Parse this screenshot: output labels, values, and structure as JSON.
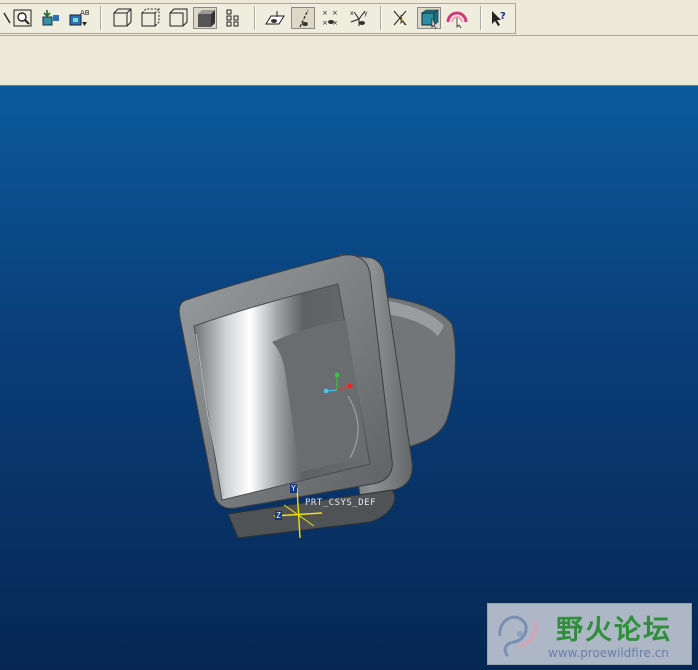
{
  "toolbar": {
    "buttons": [
      {
        "name": "partial-arrow-icon",
        "tooltip": ""
      },
      {
        "name": "zoom-window-icon",
        "tooltip": ""
      },
      {
        "name": "model-insert-icon",
        "tooltip": ""
      },
      {
        "name": "annotation-ab-icon",
        "tooltip": ""
      },
      {
        "name": "hidden-line-icon",
        "tooltip": ""
      },
      {
        "name": "no-hidden-icon",
        "tooltip": ""
      },
      {
        "name": "wireframe-icon",
        "tooltip": ""
      },
      {
        "name": "shading-icon",
        "tooltip": ""
      },
      {
        "name": "model-tree-icon",
        "tooltip": ""
      },
      {
        "name": "datum-plane-display-icon",
        "tooltip": ""
      },
      {
        "name": "datum-axis-display-icon",
        "tooltip": ""
      },
      {
        "name": "datum-point-display-icon",
        "tooltip": ""
      },
      {
        "name": "csys-display-icon",
        "tooltip": ""
      },
      {
        "name": "spin-center-icon",
        "tooltip": ""
      },
      {
        "name": "orient-mode-icon",
        "tooltip": ""
      },
      {
        "name": "appearance-icon",
        "tooltip": ""
      },
      {
        "name": "context-help-icon",
        "tooltip": ""
      }
    ]
  },
  "viewport": {
    "csys_label": "PRT_CSYS_DEF",
    "axis_labels": {
      "y": "Y",
      "z": "Z"
    }
  },
  "watermark": {
    "title": "野火论坛",
    "url": "www.proewildfire.cn"
  },
  "colors": {
    "toolbar_bg": "#ece9d8",
    "viewport_top": "#0b5a9b",
    "viewport_bottom": "#062753",
    "model_gray": "#7c7f80",
    "watermark_green": "#2f8f3a"
  }
}
